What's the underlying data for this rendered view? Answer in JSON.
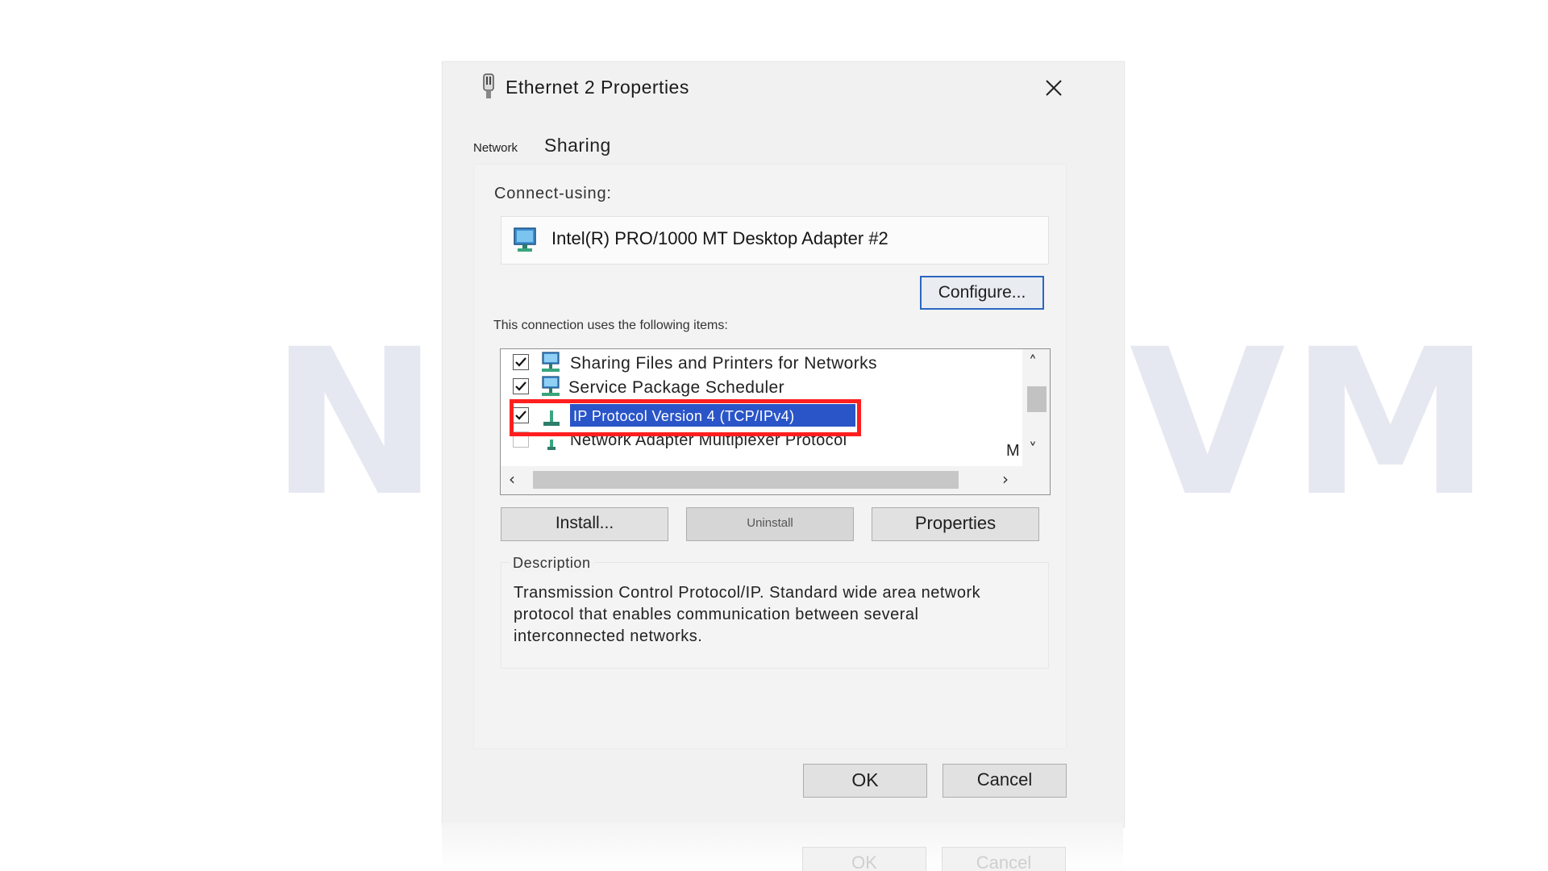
{
  "watermark": "NeuronVM",
  "dialog": {
    "title": "Ethernet 2 Properties",
    "tabs": [
      "Network",
      "Sharing"
    ],
    "connect_using_label": "Connect-using:",
    "adapter_name": "Intel(R) PRO/1000 MT Desktop Adapter #2",
    "configure_label": "Configure...",
    "items_label": "This connection uses the following items:",
    "items": [
      {
        "label": "Sharing Files and Printers for Networks",
        "checked": true,
        "icon": "network-service-icon",
        "selected": false
      },
      {
        "label": "Service Package Scheduler",
        "checked": true,
        "icon": "network-service-icon",
        "selected": false
      },
      {
        "label": "IP Protocol Version 4 (TCP/IPv4)",
        "checked": true,
        "icon": "protocol-icon",
        "selected": true
      },
      {
        "label": "Network Adapter Multiplexer Protocol",
        "checked": false,
        "icon": "protocol-icon",
        "selected": false
      }
    ],
    "truncated_item_glyph": "M",
    "install_label": "Install...",
    "uninstall_label": "Uninstall",
    "properties_label": "Properties",
    "description_title": "Description",
    "description_text": "Transmission Control Protocol/IP. Standard wide area network protocol that enables communication between several interconnected networks.",
    "ok_label": "OK",
    "cancel_label": "Cancel"
  },
  "colors": {
    "selection": "#2a55c8",
    "highlight_border": "#ff1f1f",
    "focus_border": "#2a66c1",
    "watermark": "#e6e8f1"
  }
}
